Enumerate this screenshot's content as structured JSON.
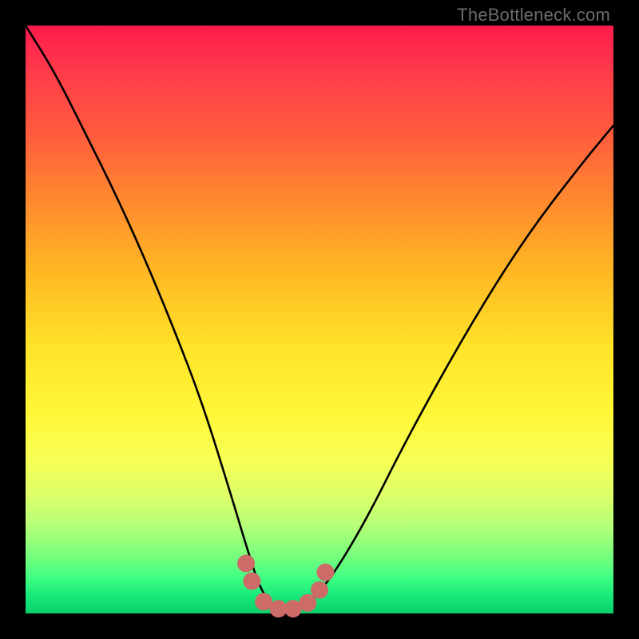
{
  "watermark": {
    "text": "TheBottleneck.com"
  },
  "chart_data": {
    "type": "line",
    "title": "",
    "xlabel": "",
    "ylabel": "",
    "xlim": [
      0,
      1
    ],
    "ylim": [
      0,
      1
    ],
    "series": [
      {
        "name": "bottleneck-curve",
        "description": "V-shaped bottleneck curve; y ≈ 1 at edges, dips to ~0 near x≈0.40–0.48",
        "x": [
          0.0,
          0.05,
          0.1,
          0.15,
          0.2,
          0.25,
          0.3,
          0.35,
          0.38,
          0.4,
          0.42,
          0.44,
          0.46,
          0.48,
          0.52,
          0.58,
          0.65,
          0.75,
          0.85,
          0.95,
          1.0
        ],
        "y": [
          1.0,
          0.92,
          0.82,
          0.72,
          0.61,
          0.49,
          0.36,
          0.2,
          0.1,
          0.04,
          0.015,
          0.005,
          0.005,
          0.015,
          0.06,
          0.16,
          0.3,
          0.48,
          0.64,
          0.77,
          0.83
        ]
      },
      {
        "name": "highlight-dots",
        "description": "Emphasis markers near the trough of the curve",
        "x": [
          0.375,
          0.385,
          0.405,
          0.43,
          0.455,
          0.48,
          0.5,
          0.51
        ],
        "y": [
          0.085,
          0.055,
          0.02,
          0.008,
          0.008,
          0.018,
          0.04,
          0.07
        ]
      }
    ],
    "colors": {
      "curve": "#000000",
      "dots": "#cc6b68",
      "gradient_top": "#ff1a4d",
      "gradient_bottom": "#0ad06d"
    }
  }
}
